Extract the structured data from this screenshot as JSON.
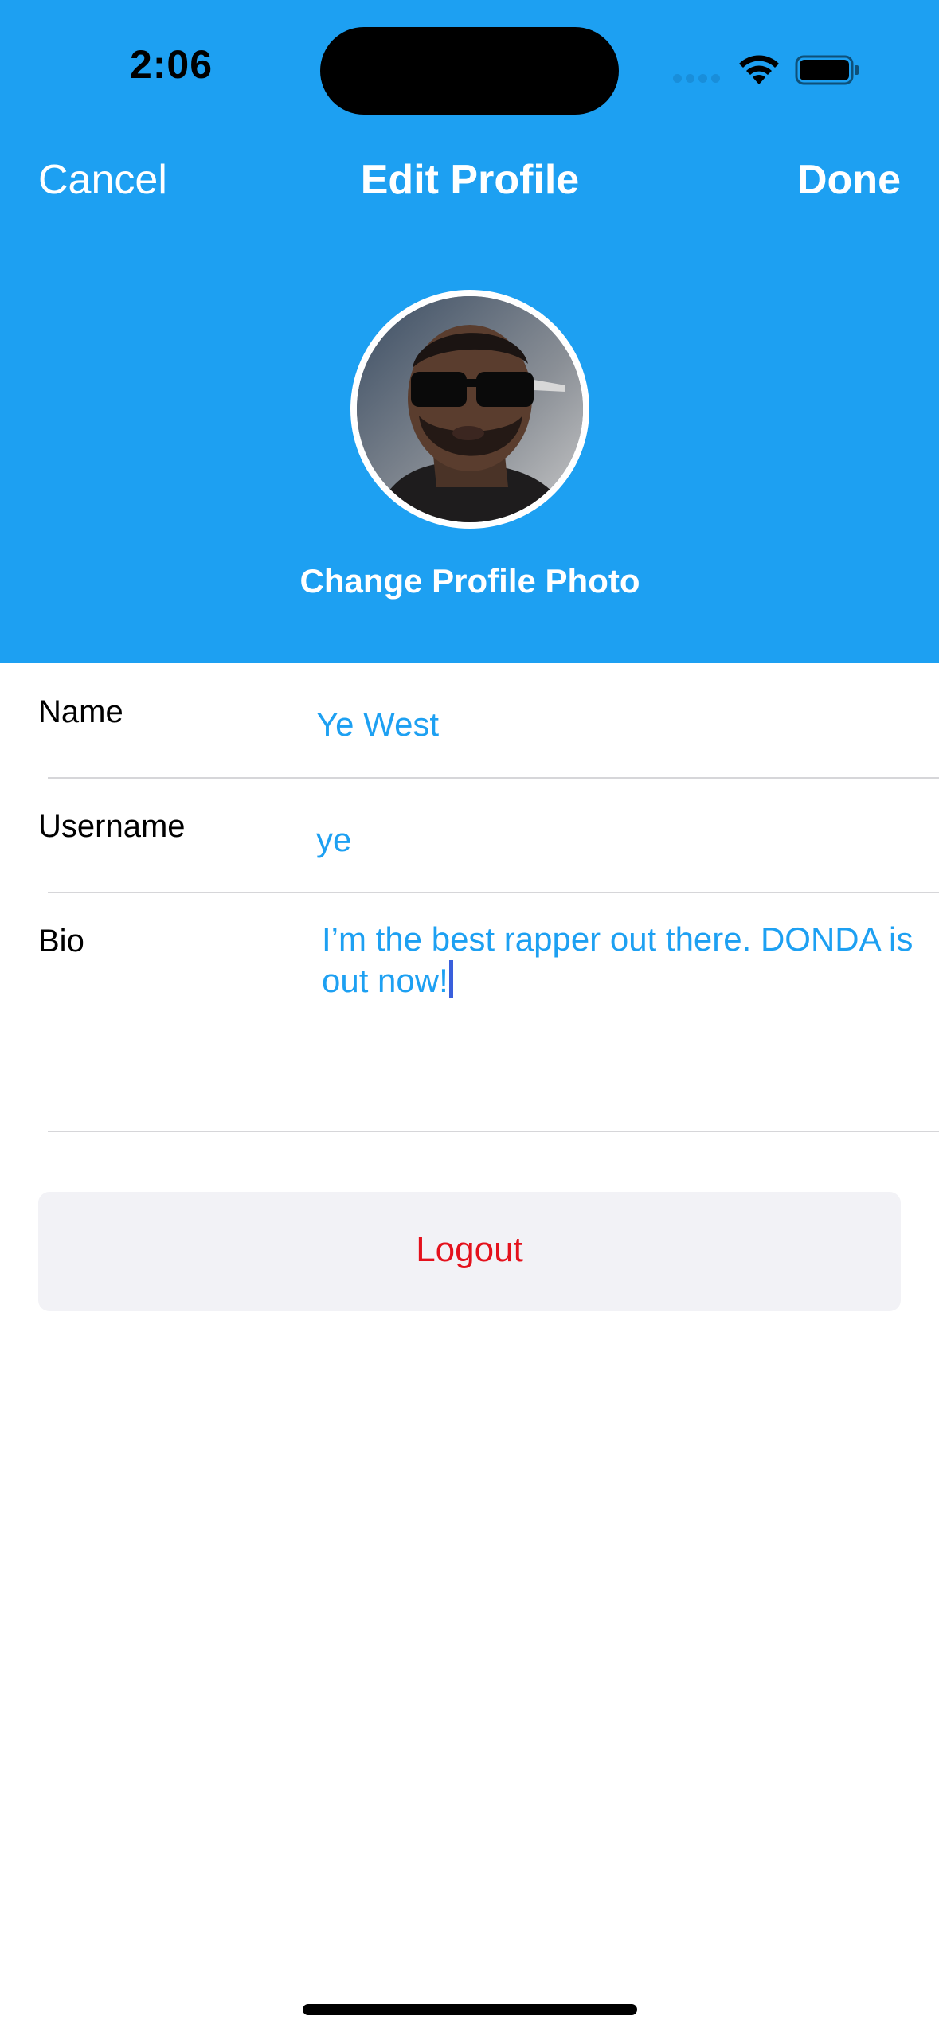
{
  "status_bar": {
    "time": "2:06",
    "icons": [
      "cellular-signal-icon",
      "wifi-icon",
      "battery-icon"
    ]
  },
  "nav": {
    "cancel_label": "Cancel",
    "title": "Edit Profile",
    "done_label": "Done"
  },
  "profile": {
    "avatar": "profile-photo",
    "change_photo_label": "Change Profile Photo"
  },
  "form": {
    "name": {
      "label": "Name",
      "value": "Ye West"
    },
    "username": {
      "label": "Username",
      "value": "ye"
    },
    "bio": {
      "label": "Bio",
      "value": "I’m the best rapper out there. DONDA is out now!"
    }
  },
  "logout_label": "Logout",
  "colors": {
    "header_bg": "#1DA0F2",
    "accent": "#1DA0F2",
    "destructive": "#E4111C",
    "button_bg": "#F2F2F6"
  }
}
